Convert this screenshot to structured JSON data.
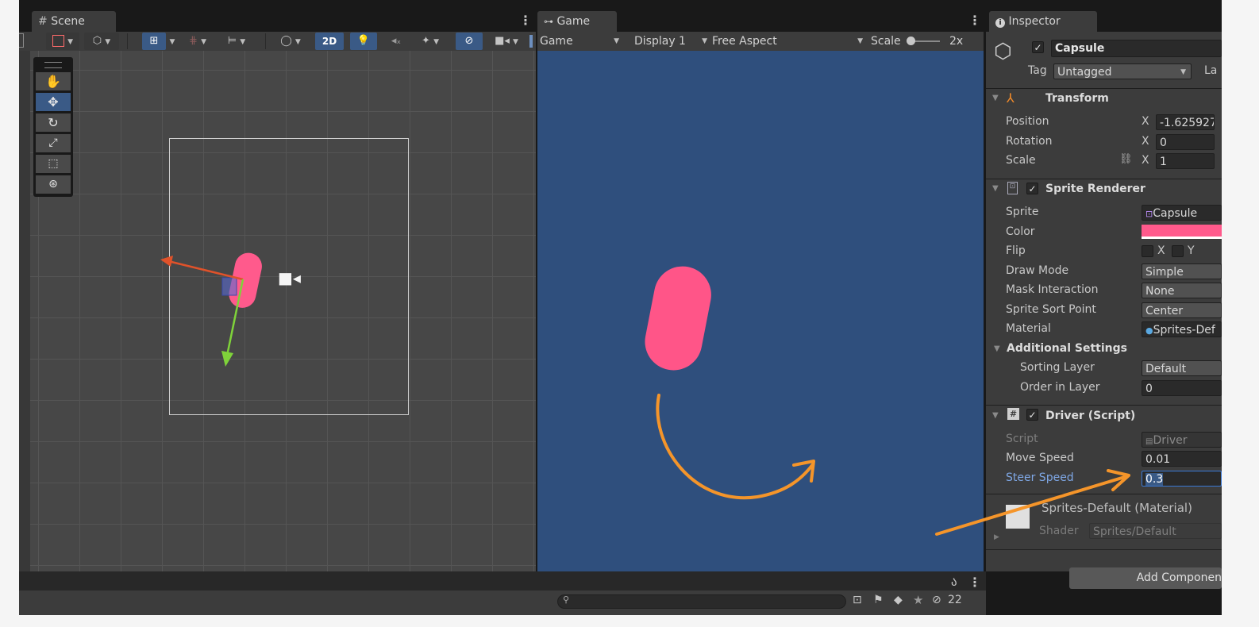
{
  "scene": {
    "tab_label": "Scene",
    "toolbar": {
      "mode_2d": "2D"
    },
    "tools": [
      "hand-tool",
      "move-tool",
      "rotate-tool",
      "scale-tool",
      "rect-tool",
      "transform-tool"
    ]
  },
  "game": {
    "tab_label": "Game",
    "view_select": "Game",
    "display_select": "Display 1",
    "aspect_select": "Free Aspect",
    "scale_label": "Scale",
    "scale_value": "2x",
    "background_color": "#2f4f7d",
    "capsule_color": "#ff5588"
  },
  "inspector": {
    "tab_label": "Inspector",
    "object_name": "Capsule",
    "tag_label": "Tag",
    "tag_value": "Untagged",
    "layer_label_partial": "La",
    "transform": {
      "title": "Transform",
      "position_label": "Position",
      "rotation_label": "Rotation",
      "scale_label": "Scale",
      "axis_x": "X",
      "position_x": "-1.625927",
      "rotation_x": "0",
      "scale_x": "1"
    },
    "sprite_renderer": {
      "title": "Sprite Renderer",
      "sprite_label": "Sprite",
      "sprite_value": "Capsule",
      "color_label": "Color",
      "color_value": "#ff5a8c",
      "flip_label": "Flip",
      "flip_x": "X",
      "flip_y": "Y",
      "draw_mode_label": "Draw Mode",
      "draw_mode_value": "Simple",
      "mask_label": "Mask Interaction",
      "mask_value": "None",
      "sort_point_label": "Sprite Sort Point",
      "sort_point_value": "Center",
      "material_label": "Material",
      "material_value": "Sprites-Def",
      "additional_title": "Additional Settings",
      "sorting_layer_label": "Sorting Layer",
      "sorting_layer_value": "Default",
      "order_label": "Order in Layer",
      "order_value": "0"
    },
    "driver": {
      "title": "Driver (Script)",
      "script_label": "Script",
      "script_value": "Driver",
      "move_speed_label": "Move Speed",
      "move_speed_value": "0.01",
      "steer_speed_label": "Steer Speed",
      "steer_speed_value": "0.3"
    },
    "material": {
      "name": "Sprites-Default (Material)",
      "shader_label": "Shader",
      "shader_value": "Sprites/Default"
    },
    "add_component_label": "Add Componen"
  },
  "bottom": {
    "search_placeholder": "",
    "hidden_count": "22"
  },
  "colors": {
    "arrow_orange": "#f5952a",
    "selection_blue": "#3a5a86"
  }
}
